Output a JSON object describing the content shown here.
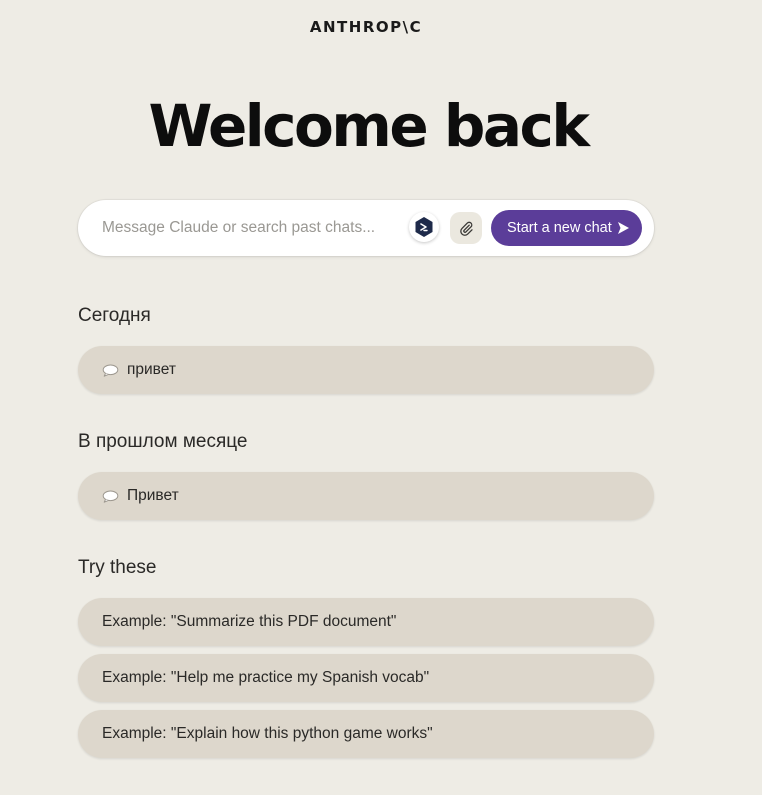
{
  "brand": {
    "logo_text": "ANTHROP\\C"
  },
  "header": {
    "title": "Welcome back"
  },
  "search": {
    "placeholder": "Message Claude or search past chats...",
    "value": "",
    "extension_icon": "extension-logo-icon",
    "attach_icon": "paperclip-icon",
    "new_chat_label": "Start a new chat",
    "new_chat_icon": "send-arrow-icon",
    "accent_color": "#5b3d99"
  },
  "sections": {
    "today": {
      "title": "Сегодня",
      "items": [
        {
          "label": "привет",
          "icon": "chat-bubble-icon"
        }
      ]
    },
    "last_month": {
      "title": "В прошлом месяце",
      "items": [
        {
          "label": "Привет",
          "icon": "chat-bubble-icon"
        }
      ]
    },
    "try_these": {
      "title": "Try these",
      "items": [
        {
          "label": "Example: \"Summarize this PDF document\""
        },
        {
          "label": "Example: \"Help me practice my Spanish vocab\""
        },
        {
          "label": "Example: \"Explain how this python game works\""
        }
      ]
    }
  }
}
